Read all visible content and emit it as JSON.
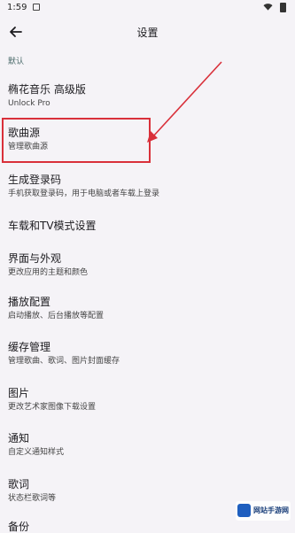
{
  "status": {
    "time": "1:59"
  },
  "header": {
    "title": "设置"
  },
  "section": {
    "label": "默认"
  },
  "items": [
    {
      "title": "椭花音乐 高级版",
      "subtitle": "Unlock Pro"
    },
    {
      "title": "歌曲源",
      "subtitle": "管理歌曲源"
    },
    {
      "title": "生成登录码",
      "subtitle": "手机获取登录码，用于电脑或者车载上登录"
    },
    {
      "title": "车载和TV模式设置",
      "subtitle": ""
    },
    {
      "title": "界面与外观",
      "subtitle": "更改应用的主题和颜色"
    },
    {
      "title": "播放配置",
      "subtitle": "启动播放、后台播放等配置"
    },
    {
      "title": "缓存管理",
      "subtitle": "管理歌曲、歌词、图片封面缓存"
    },
    {
      "title": "图片",
      "subtitle": "更改艺术家图像下载设置"
    },
    {
      "title": "通知",
      "subtitle": "自定义通知样式"
    },
    {
      "title": "歌词",
      "subtitle": "状态栏歌词等"
    },
    {
      "title": "备份",
      "subtitle": ""
    }
  ],
  "watermark": {
    "text": "网站手游网"
  },
  "colors": {
    "highlight": "#d9303a",
    "background": "#f5f3f7"
  }
}
